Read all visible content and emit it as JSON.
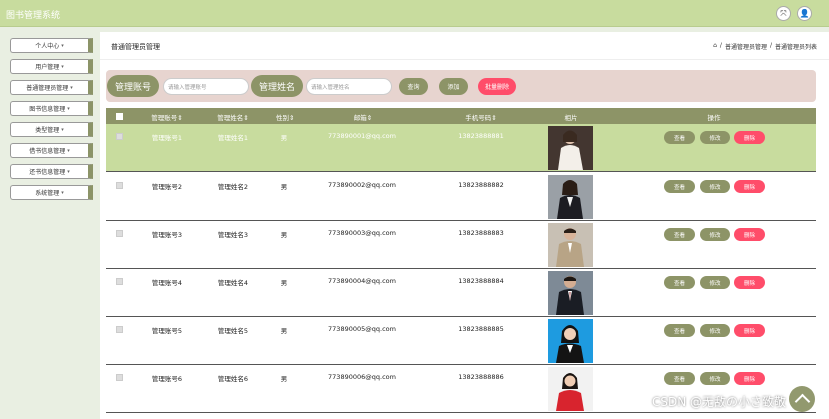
{
  "app": {
    "title": "图书管理系统"
  },
  "topbar": {
    "fullscreen_icon": "⤧",
    "user_icon": "👤"
  },
  "sidebar": {
    "items": [
      {
        "label": "个人中心"
      },
      {
        "label": "用户管理"
      },
      {
        "label": "普通管理员管理"
      },
      {
        "label": "图书信息管理"
      },
      {
        "label": "类型管理"
      },
      {
        "label": "借书信息管理"
      },
      {
        "label": "还书信息管理"
      },
      {
        "label": "系统管理"
      }
    ]
  },
  "page": {
    "title": "普通管理员管理",
    "breadcrumb": {
      "home_icon": "⌂",
      "sep": "/",
      "level1": "普通管理员管理",
      "level2": "普通管理员列表"
    }
  },
  "search": {
    "account_label": "管理账号",
    "account_placeholder": "请输入管理账号",
    "name_label": "管理姓名",
    "name_placeholder": "请输入管理姓名",
    "query_btn": "查询",
    "add_btn": "添加",
    "batch_delete_btn": "批量删除"
  },
  "table": {
    "headers": {
      "account": "管理账号⇕",
      "name": "管理姓名⇕",
      "gender": "性别⇕",
      "email": "邮箱⇕",
      "phone": "手机号码⇕",
      "photo": "相片",
      "actions": "操作"
    },
    "action_labels": {
      "view": "查看",
      "edit": "修改",
      "delete": "删除"
    },
    "rows": [
      {
        "account": "管理账号1",
        "name": "管理姓名1",
        "gender": "男",
        "email": "773890001@qq.com",
        "phone": "13823888881"
      },
      {
        "account": "管理账号2",
        "name": "管理姓名2",
        "gender": "男",
        "email": "773890002@qq.com",
        "phone": "13823888882"
      },
      {
        "account": "管理账号3",
        "name": "管理姓名3",
        "gender": "男",
        "email": "773890003@qq.com",
        "phone": "13823888883"
      },
      {
        "account": "管理账号4",
        "name": "管理姓名4",
        "gender": "男",
        "email": "773890004@qq.com",
        "phone": "13823888884"
      },
      {
        "account": "管理账号5",
        "name": "管理姓名5",
        "gender": "男",
        "email": "773890005@qq.com",
        "phone": "13823888885"
      },
      {
        "account": "管理账号6",
        "name": "管理姓名6",
        "gender": "男",
        "email": "773890006@qq.com",
        "phone": "13823888886"
      }
    ]
  },
  "watermark": "CSDN @无敌の小さ致敬",
  "colors": {
    "accent": "#8d9467",
    "topbar": "#c8dc9e",
    "danger": "#ff4d6a",
    "selected_row": "#c8dc9e"
  }
}
